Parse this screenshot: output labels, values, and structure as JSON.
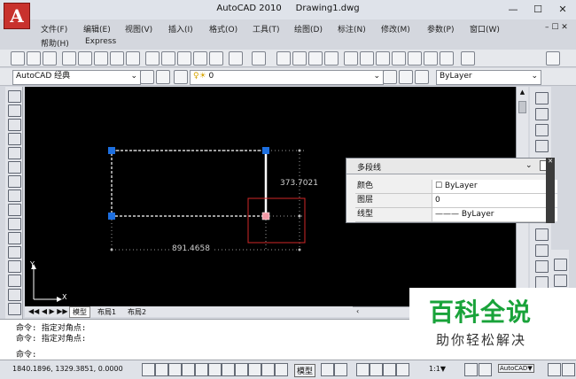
{
  "app": {
    "title": "AutoCAD 2010",
    "document": "Drawing1.dwg",
    "logo_letter": "A"
  },
  "window_controls": {
    "minimize": "—",
    "maximize": "☐",
    "close": "✕"
  },
  "menu": {
    "row1": [
      "文件(F)",
      "编辑(E)",
      "视图(V)",
      "插入(I)",
      "格式(O)",
      "工具(T)",
      "绘图(D)",
      "标注(N)",
      "修改(M)",
      "参数(P)",
      "窗口(W)"
    ],
    "row2": [
      "帮助(H)",
      "Express"
    ],
    "doc_controls": "– ☐ ✕"
  },
  "toolbar2": {
    "workspace": "AutoCAD 经典",
    "layer": "0",
    "bylayer": "ByLayer"
  },
  "drawing": {
    "dimension_vertical": "373.7021",
    "dimension_horizontal": "891.4658",
    "ucs_y": "Y",
    "ucs_x": "X"
  },
  "properties": {
    "object_type": "多段线",
    "rows": [
      {
        "key": "颜色",
        "value": "☐ ByLayer"
      },
      {
        "key": "图层",
        "value": "0"
      },
      {
        "key": "线型",
        "value": "——— ByLayer"
      }
    ]
  },
  "tabs": {
    "nav": "◀◀ ◀ ▶ ▶▶",
    "model": "模型",
    "layout1": "布局1",
    "layout2": "布局2"
  },
  "command": {
    "line1": "命令: 指定对角点:",
    "line2": "命令: 指定对角点:",
    "prompt": "命令:"
  },
  "status": {
    "coords": "1840.1896,  1329.3851,  0.0000",
    "model": "模型",
    "scale": "1:1▼",
    "autocad": "AutoCAD▼"
  },
  "watermark": {
    "title": "百科全说",
    "subtitle": "助你轻松解决"
  },
  "colors": {
    "grip": "#1d6fe0",
    "grip_hot": "#f29aa6",
    "selection_box": "#d12828",
    "watermark_green": "#19a33a"
  }
}
